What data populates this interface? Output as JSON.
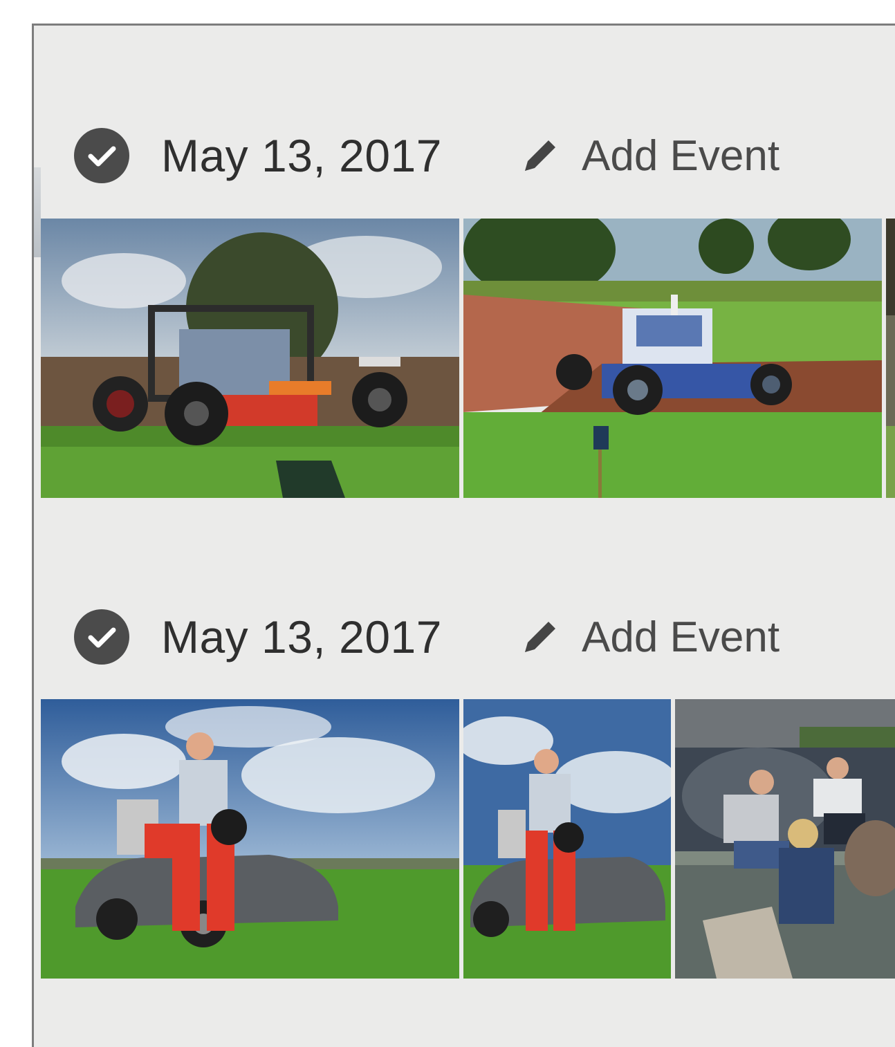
{
  "groups": [
    {
      "date": "May 13, 2017",
      "add_event_label": "Add Event",
      "selected": true,
      "photos": [
        {
          "subject": "buggy-on-dirt"
        },
        {
          "subject": "buggy-kicking-dust"
        },
        {
          "subject": "cut-off"
        }
      ]
    },
    {
      "date": "May 13, 2017",
      "add_event_label": "Add Event",
      "selected": true,
      "photos": [
        {
          "subject": "driver-on-car"
        },
        {
          "subject": "driver-on-car-narrow"
        },
        {
          "subject": "people-sitting"
        }
      ]
    }
  ],
  "colors": {
    "background": "#ebebea",
    "icon": "#4b4b4b",
    "text": "#2f2f2f",
    "frame_border": "#7d7d7d"
  },
  "icons": [
    "check-circle-icon",
    "pencil-icon"
  ]
}
